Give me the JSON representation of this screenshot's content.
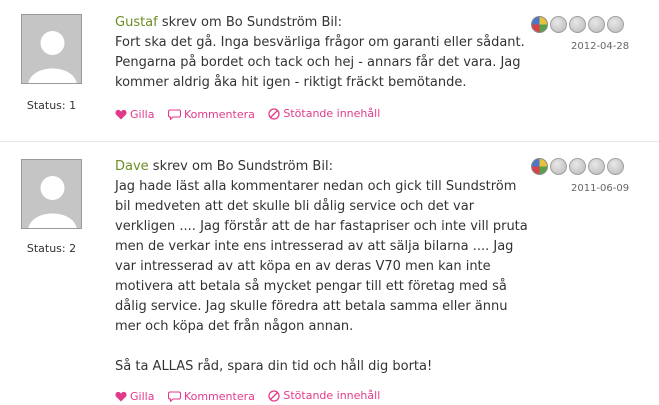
{
  "reviews": [
    {
      "author": "Gustaf",
      "verb": " skrev om ",
      "target": "Bo Sundström Bil",
      "colon": ":",
      "status": "Status: 1",
      "date": "2012-04-28",
      "rating": 1,
      "paragraphs": [
        "Fort ska det gå. Inga besvärliga frågor om garanti eller sådant. Pengarna på bordet och tack och hej - annars får det vara. Jag kommer aldrig åka hit igen - riktigt fräckt bemötande."
      ],
      "actions": {
        "like": "Gilla",
        "comment": "Kommentera",
        "report": "Stötande innehåll"
      }
    },
    {
      "author": "Dave",
      "verb": " skrev om ",
      "target": "Bo Sundström Bil",
      "colon": ":",
      "status": "Status: 2",
      "date": "2011-06-09",
      "rating": 1,
      "paragraphs": [
        "Jag hade läst alla kommentarer nedan och gick till Sundström bil medveten att det skulle bli dålig service och det var verkligen .... Jag förstår att de har fastapriser och inte vill pruta men de verkar inte ens intresserad av att sälja bilarna .... Jag var intresserad av att köpa en av deras V70 men kan inte motivera att betala så mycket pengar till ett företag med så dålig service. Jag skulle föredra att betala samma eller ännu mer och köpa det från någon annan.",
        "Så ta ALLAS råd, spara din tid och håll dig borta!"
      ],
      "actions": {
        "like": "Gilla",
        "comment": "Kommentera",
        "report": "Stötande innehåll"
      }
    }
  ],
  "icons": {
    "like": "heart-icon",
    "comment": "speech-bubble-icon",
    "report": "prohibited-icon",
    "rating": "rating-dot-icon"
  },
  "colors": {
    "author": "#6b8e23",
    "action": "#e23a8a",
    "text": "#333333",
    "date": "#666666",
    "avatar_bg": "#c5c5c5"
  }
}
